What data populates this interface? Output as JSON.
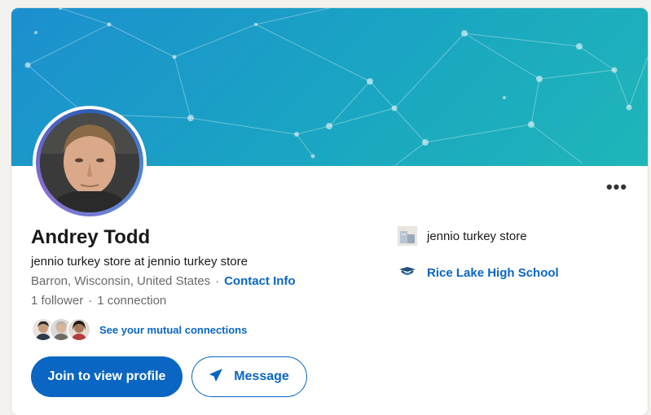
{
  "profile": {
    "name": "Andrey Todd",
    "headline": "jennio turkey store at jennio turkey store",
    "location": "Barron, Wisconsin, United States",
    "location_separator": "·",
    "contact_info_label": "Contact Info",
    "followers": "1 follower",
    "connections_separator": "·",
    "connections": "1 connection",
    "mutual_connections_label": "See your mutual connections",
    "more_label": "•••"
  },
  "actions": {
    "join_label": "Join to view profile",
    "message_label": "Message"
  },
  "experience": {
    "company_name": "jennio turkey store",
    "school_name": "Rice Lake High School"
  },
  "colors": {
    "brand_blue": "#0a66c2",
    "cover_start": "#1c8fcf",
    "cover_end": "#1fb6b8"
  },
  "icons": {
    "more": "more-horizontal-icon",
    "message": "paper-plane-icon",
    "company": "company-logo-icon",
    "school": "school-logo-icon"
  }
}
